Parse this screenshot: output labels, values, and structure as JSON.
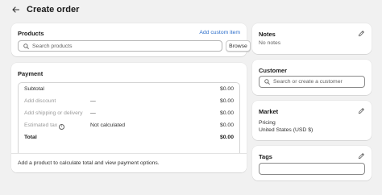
{
  "header": {
    "title": "Create order"
  },
  "products": {
    "title": "Products",
    "add_custom_item": "Add custom item",
    "search_placeholder": "Search products",
    "browse_label": "Browse"
  },
  "payment": {
    "title": "Payment",
    "rows": [
      {
        "label": "Subtotal",
        "mid": "",
        "amount": "$0.00"
      },
      {
        "label": "Add discount",
        "mid": "—",
        "amount": "$0.00"
      },
      {
        "label": "Add shipping or delivery",
        "mid": "—",
        "amount": "$0.00"
      },
      {
        "label": "Estimated tax",
        "mid": "Not calculated",
        "amount": "$0.00"
      },
      {
        "label": "Total",
        "mid": "",
        "amount": "$0.00"
      }
    ],
    "footer_text": "Add a product to calculate total and view payment options."
  },
  "notes": {
    "title": "Notes",
    "text": "No notes"
  },
  "customer": {
    "title": "Customer",
    "search_placeholder": "Search or create a customer"
  },
  "market": {
    "title": "Market",
    "pricing_label": "Pricing",
    "pricing_value": "United States (USD $)"
  },
  "tags": {
    "title": "Tags",
    "value": ""
  },
  "colors": {
    "background": "#f1f1f1",
    "card": "#ffffff",
    "link": "#2c6ecb"
  }
}
